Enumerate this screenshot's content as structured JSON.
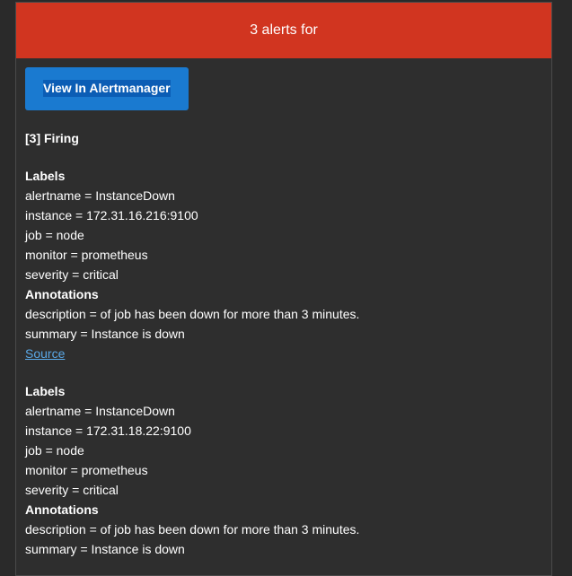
{
  "header": {
    "title": "3 alerts for"
  },
  "button": {
    "label": "View In Alertmanager"
  },
  "firing": {
    "label": "[3] Firing"
  },
  "alerts": [
    {
      "labels_heading": "Labels",
      "labels": [
        "alertname = InstanceDown",
        "instance = 172.31.16.216:9100",
        "job = node",
        "monitor = prometheus",
        "severity = critical"
      ],
      "annotations_heading": "Annotations",
      "annotations": [
        "description = of job has been down for more than 3 minutes.",
        "summary = Instance is down"
      ],
      "source_label": "Source"
    },
    {
      "labels_heading": "Labels",
      "labels": [
        "alertname = InstanceDown",
        "instance = 172.31.18.22:9100",
        "job = node",
        "monitor = prometheus",
        "severity = critical"
      ],
      "annotations_heading": "Annotations",
      "annotations": [
        "description = of job has been down for more than 3 minutes.",
        "summary = Instance is down"
      ]
    }
  ],
  "colors": {
    "header_bg": "#d13520",
    "button_bg": "#1a7ad0",
    "link": "#5aa8e6",
    "body_bg": "#2e2e2e"
  }
}
